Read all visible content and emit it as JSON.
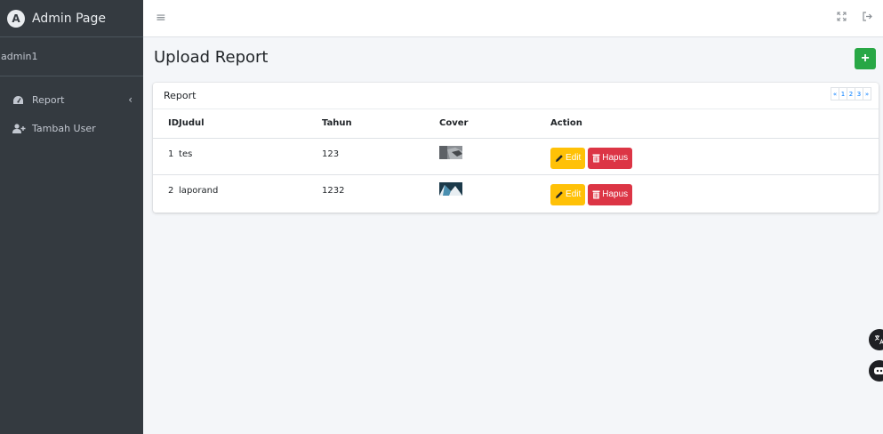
{
  "brand": {
    "title": "Admin Page",
    "logo_letter": "A"
  },
  "user": {
    "name": "admin1"
  },
  "sidebar": {
    "items": [
      {
        "label": "Report",
        "icon": "dashboard-gauge-icon",
        "has_chevron": true
      },
      {
        "label": "Tambah User",
        "icon": "user-plus-icon",
        "has_chevron": false
      }
    ]
  },
  "topbar": {
    "menu_icon": "hamburger-icon",
    "right_icons": [
      "fullscreen-icon",
      "logout-icon"
    ]
  },
  "page": {
    "title": "Upload Report",
    "add_label": "+"
  },
  "card": {
    "title": "Report",
    "pagination": [
      "«",
      "1",
      "2",
      "3",
      "»"
    ],
    "columns": [
      "ID",
      "Judul",
      "Tahun",
      "Cover",
      "Action"
    ],
    "rows": [
      {
        "id": "1",
        "judul": "tes",
        "tahun": "123",
        "cover": "grey-photo"
      },
      {
        "id": "2",
        "judul": "laporand",
        "tahun": "1232",
        "cover": "blue-photo"
      }
    ],
    "edit_label": "Edit",
    "hapus_label": "Hapus"
  },
  "colors": {
    "sidebar": "#343a40",
    "add_button": "#28a745",
    "edit_button": "#ffc107",
    "hapus_button": "#dc3545",
    "content_bg": "#f4f6f9"
  }
}
